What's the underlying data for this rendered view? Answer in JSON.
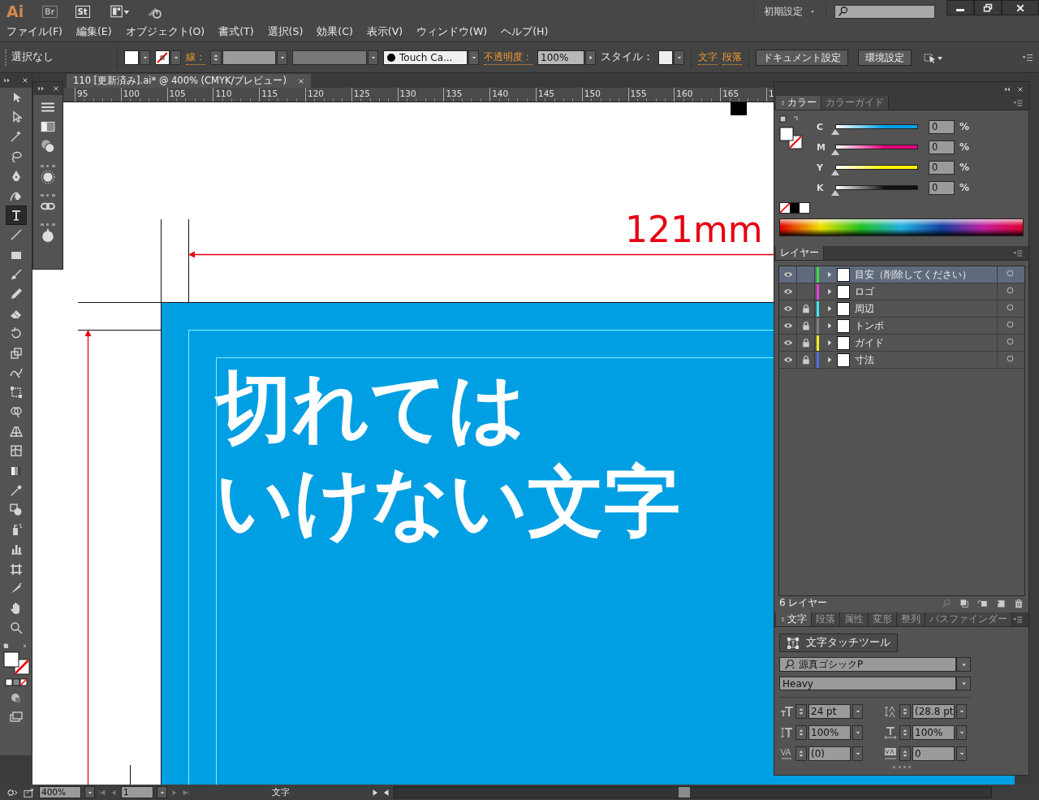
{
  "app_bar": {
    "logo": "Ai",
    "bridge": "Br",
    "stock": "St",
    "workspace": "初期設定"
  },
  "menu": [
    "ファイル(F)",
    "編集(E)",
    "オブジェクト(O)",
    "書式(T)",
    "選択(S)",
    "効果(C)",
    "表示(V)",
    "ウィンドウ(W)",
    "ヘルプ(H)"
  ],
  "control_bar": {
    "selection": "選択なし",
    "stroke_label": "線：",
    "brush": "Touch Ca...",
    "opacity_label": "不透明度：",
    "opacity": "100%",
    "style_label": "スタイル：",
    "links": [
      "文字",
      "段落"
    ],
    "buttons": [
      "ドキュメント設定",
      "環境設定"
    ]
  },
  "document_tab": {
    "title": "110 [更新済み].ai* @ 400% (CMYK/プレビュー)"
  },
  "ruler": [
    "95",
    "100",
    "105",
    "110",
    "115",
    "120",
    "125",
    "130",
    "135",
    "140",
    "145",
    "150",
    "155",
    "160",
    "165",
    "1"
  ],
  "tools": [
    {
      "selected": false
    },
    {
      "selected": false
    },
    {
      "selected": false
    },
    {
      "selected": false
    },
    {
      "selected": false
    },
    {
      "selected": false
    },
    {
      "selected": true
    },
    {
      "selected": false
    },
    {
      "selected": false
    },
    {
      "selected": false
    },
    {
      "selected": false
    },
    {
      "selected": false
    },
    {
      "selected": false
    },
    {
      "selected": false
    },
    {
      "selected": false
    },
    {
      "selected": false
    },
    {
      "selected": false
    },
    {
      "selected": false
    },
    {
      "selected": false
    },
    {
      "selected": false
    },
    {
      "selected": false
    },
    {
      "selected": false
    },
    {
      "selected": false
    },
    {
      "selected": false
    },
    {
      "selected": false
    },
    {
      "selected": false
    },
    {
      "selected": false
    },
    {
      "selected": false
    }
  ],
  "artwork": {
    "dimension": "121mm",
    "headline": [
      "切れては",
      "いけない文字"
    ]
  },
  "color_panel": {
    "tabs": [
      {
        "label": "カラー",
        "selected": true
      },
      {
        "label": "カラーガイド",
        "selected": false
      }
    ],
    "channels": [
      {
        "label": "C",
        "value": "0",
        "unit": "%",
        "level": 0,
        "color": "#00a0e9"
      },
      {
        "label": "M",
        "value": "0",
        "unit": "%",
        "level": 0,
        "color": "#e4007f"
      },
      {
        "label": "Y",
        "value": "0",
        "unit": "%",
        "level": 0,
        "color": "#fff100"
      },
      {
        "label": "K",
        "value": "0",
        "unit": "%",
        "level": 0,
        "color": "#111111"
      }
    ]
  },
  "layers_panel": {
    "tab": "レイヤー",
    "count": "6 レイヤー",
    "layers": [
      {
        "name": "目安（削除してください）",
        "color": "#3ddc3d",
        "visible": true,
        "locked": false,
        "selected": true
      },
      {
        "name": "ロゴ",
        "color": "#e040e0",
        "visible": true,
        "locked": false,
        "selected": false
      },
      {
        "name": "周辺",
        "color": "#40e8f0",
        "visible": true,
        "locked": true,
        "selected": false
      },
      {
        "name": "トンボ",
        "color": "#808080",
        "visible": true,
        "locked": true,
        "selected": false
      },
      {
        "name": "ガイド",
        "color": "#f0f020",
        "visible": true,
        "locked": true,
        "selected": false
      },
      {
        "name": "寸法",
        "color": "#4f6fe8",
        "visible": true,
        "locked": true,
        "selected": false
      }
    ]
  },
  "character_panel": {
    "tabs": [
      {
        "label": "文字",
        "selected": true
      },
      {
        "label": "段落",
        "selected": false
      },
      {
        "label": "属性",
        "selected": false
      },
      {
        "label": "変形",
        "selected": false
      },
      {
        "label": "整列",
        "selected": false
      },
      {
        "label": "パスファインダー",
        "selected": false
      }
    ],
    "touch_tool": "文字タッチツール",
    "font": "源真ゴシックP",
    "style": "Heavy",
    "fields": [
      {
        "kind": "size",
        "value": "24 pt"
      },
      {
        "kind": "leading",
        "value": "(28.8 pt"
      },
      {
        "kind": "vscale",
        "value": "100%"
      },
      {
        "kind": "hscale",
        "value": "100%"
      },
      {
        "kind": "kerning",
        "value": "(0)"
      },
      {
        "kind": "tracking",
        "value": "0"
      }
    ]
  },
  "status_bar": {
    "zoom": "400%",
    "artboard": "1",
    "tool": "文字"
  }
}
